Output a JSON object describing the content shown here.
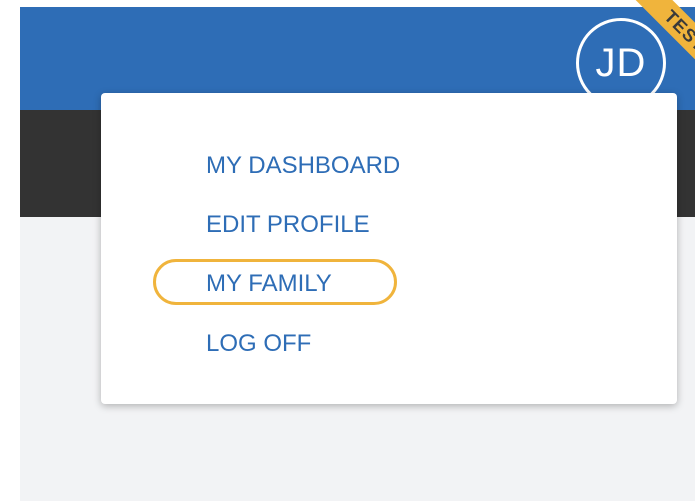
{
  "header": {
    "avatar_initials": "JD",
    "environment_ribbon": "TEST"
  },
  "user_menu": {
    "items": [
      {
        "label": "MY DASHBOARD"
      },
      {
        "label": "EDIT PROFILE"
      },
      {
        "label": "MY FAMILY",
        "highlighted": true
      },
      {
        "label": "LOG OFF"
      }
    ]
  },
  "colors": {
    "header_blue": "#2e6db6",
    "subnav_dark": "#333333",
    "content_gray": "#f2f3f5",
    "menu_text": "#2e6db6",
    "highlight_gold": "#f0b43c"
  },
  "icons": {
    "avatar": "user-avatar-icon"
  }
}
